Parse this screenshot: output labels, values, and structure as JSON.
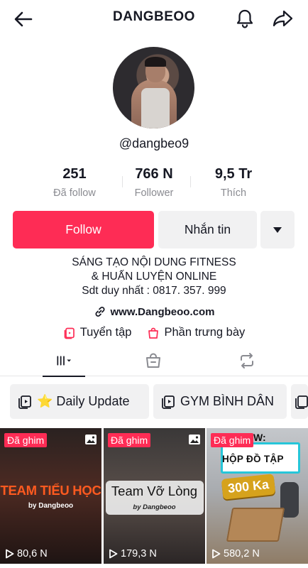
{
  "header": {
    "title": "DANGBEOO"
  },
  "profile": {
    "username": "@dangbeo9"
  },
  "stats": [
    {
      "value": "251",
      "label": "Đã follow"
    },
    {
      "value": "766 N",
      "label": "Follower"
    },
    {
      "value": "9,5 Tr",
      "label": "Thích"
    }
  ],
  "actions": {
    "follow": "Follow",
    "message": "Nhắn tin"
  },
  "bio": {
    "line1": "SÁNG TẠO NỘI DUNG FITNESS",
    "line2": "& HUẤN LUYỆN ONLINE",
    "line3": "Sdt duy nhất : 0817. 357. 999"
  },
  "link": {
    "text": "www.Dangbeoo.com"
  },
  "chips": {
    "collection": "Tuyển tập",
    "showcase": "Phần trưng bày"
  },
  "playlists": [
    {
      "label": "⭐ Daily Update"
    },
    {
      "label": "GYM BÌNH DÂN"
    }
  ],
  "videos": [
    {
      "pinned": "Đã ghim",
      "caption": "TEAM TIỂU HỌC",
      "byline": "by Dangbeoo",
      "views": "80,6 N"
    },
    {
      "pinned": "Đã ghim",
      "caption": "Team Vỡ Lòng",
      "byline": "by Dangbeoo",
      "views": "179,3 N"
    },
    {
      "pinned": "Đã ghim",
      "caption_top": "REVIEW:",
      "caption": "HỘP ĐỒ TẬP",
      "price": "300 Ka",
      "views": "580,2 N"
    }
  ],
  "colors": {
    "accent": "#fe2c55",
    "button_gray": "#f1f1f2",
    "text": "#161823",
    "muted": "#8a8b91"
  }
}
